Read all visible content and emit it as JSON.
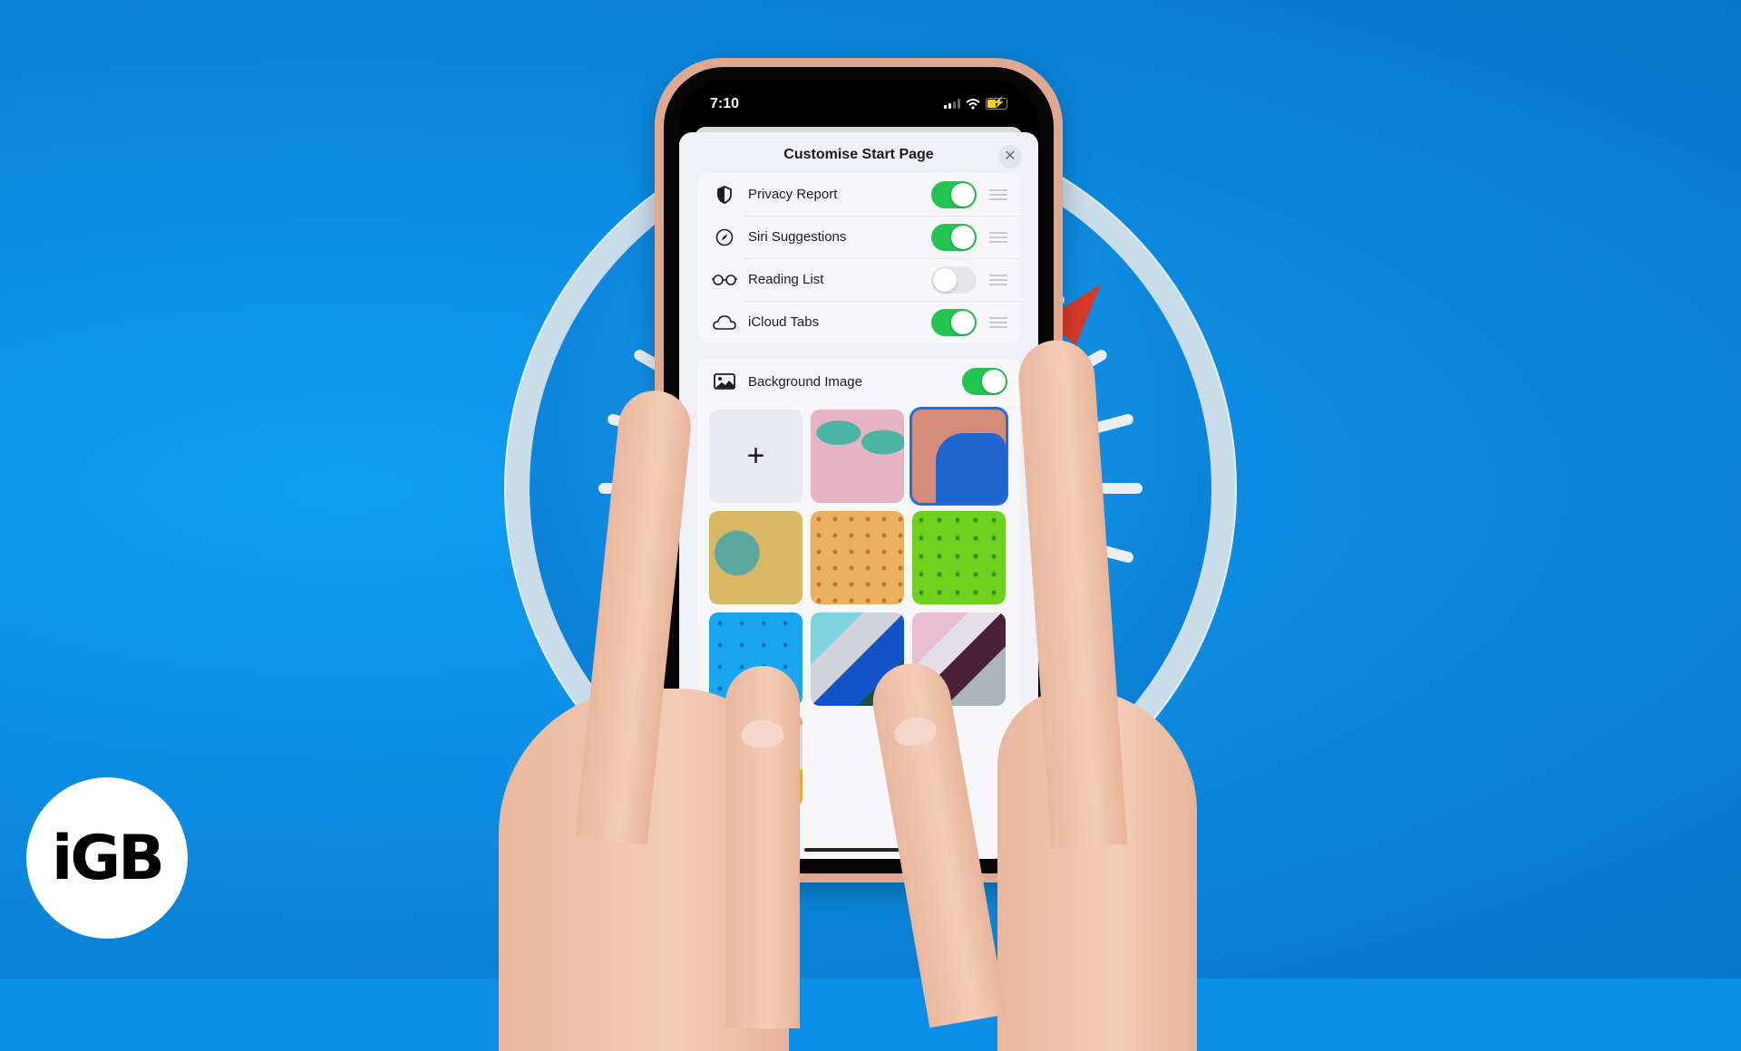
{
  "status_bar": {
    "time": "7:10",
    "icons": [
      "cellular-signal-icon",
      "wifi-icon",
      "battery-charging-icon"
    ]
  },
  "sheet": {
    "title": "Customise Start Page",
    "close_icon": "close-icon",
    "sections": [
      {
        "label": "Privacy Report",
        "icon": "shield-icon",
        "enabled": true
      },
      {
        "label": "Siri Suggestions",
        "icon": "compass-icon",
        "enabled": true
      },
      {
        "label": "Reading List",
        "icon": "glasses-icon",
        "enabled": false
      },
      {
        "label": "iCloud Tabs",
        "icon": "cloud-icon",
        "enabled": true
      }
    ],
    "background_image": {
      "label": "Background Image",
      "icon": "photo-icon",
      "enabled": true,
      "add_label": "+",
      "tiles": [
        {
          "name": "add-photo",
          "selected": false
        },
        {
          "name": "butterfly",
          "selected": false
        },
        {
          "name": "bear",
          "selected": true
        },
        {
          "name": "parrot",
          "selected": false
        },
        {
          "name": "orange-dots",
          "selected": false
        },
        {
          "name": "green-dots",
          "selected": false
        },
        {
          "name": "blue-dots",
          "selected": false
        },
        {
          "name": "blue-triangles",
          "selected": false
        },
        {
          "name": "pink-triangles",
          "selected": false
        },
        {
          "name": "orange-partial",
          "selected": false
        }
      ]
    }
  },
  "branding": {
    "logo_text": "iGB"
  },
  "colors": {
    "background_blue": "#0c8fe6",
    "toggle_on": "#23c550",
    "selection_blue": "#1e6ee0",
    "phone_case": "#e0a891"
  }
}
